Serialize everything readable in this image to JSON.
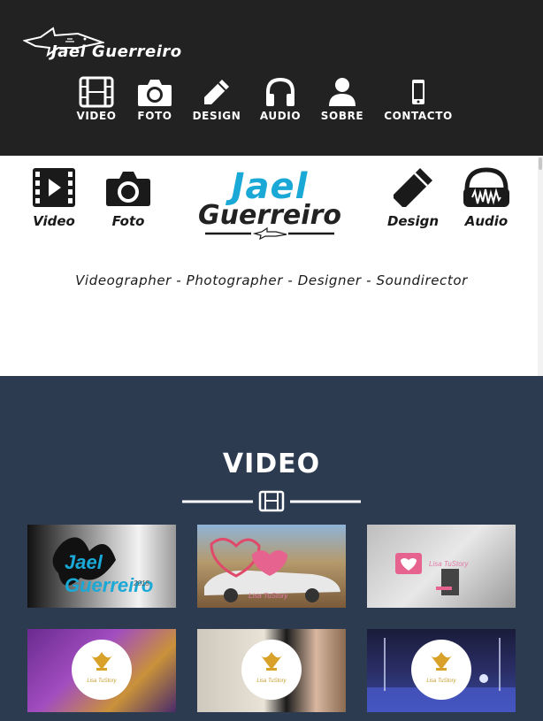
{
  "header": {
    "brand_name": "Jael Guerreiro",
    "nav": [
      {
        "label": "VIDEO",
        "icon": "film-icon"
      },
      {
        "label": "FOTO",
        "icon": "camera-icon"
      },
      {
        "label": "DESIGN",
        "icon": "pencil-icon"
      },
      {
        "label": "AUDIO",
        "icon": "headphones-icon"
      },
      {
        "label": "SOBRE",
        "icon": "user-icon"
      },
      {
        "label": "CONTACTO",
        "icon": "phone-icon"
      }
    ]
  },
  "hero": {
    "items": [
      {
        "label": "Video",
        "icon": "play-film-icon"
      },
      {
        "label": "Foto",
        "icon": "camera-icon"
      },
      {
        "label": "Design",
        "icon": "pencil-icon"
      },
      {
        "label": "Audio",
        "icon": "headphones-wave-icon"
      }
    ],
    "brand_line1": "Jael",
    "brand_line2": "Guerreiro",
    "tagline": "Videographer - Photographer - Designer - Soundirector"
  },
  "video_section": {
    "title": "VIDEO",
    "thumbnails": [
      {
        "caption": "Jael Guerreiro",
        "sub": "2015"
      },
      {
        "caption": "Lisa TuStory"
      },
      {
        "caption": "Lisa TuStory"
      },
      {
        "caption": "Lisa TuStory"
      },
      {
        "caption": "Lisa TuStory"
      },
      {
        "caption": "Lisa TuStory"
      }
    ]
  },
  "colors": {
    "topbar": "#222222",
    "accent": "#1aa9d6",
    "section_bg": "#2c3b50"
  }
}
